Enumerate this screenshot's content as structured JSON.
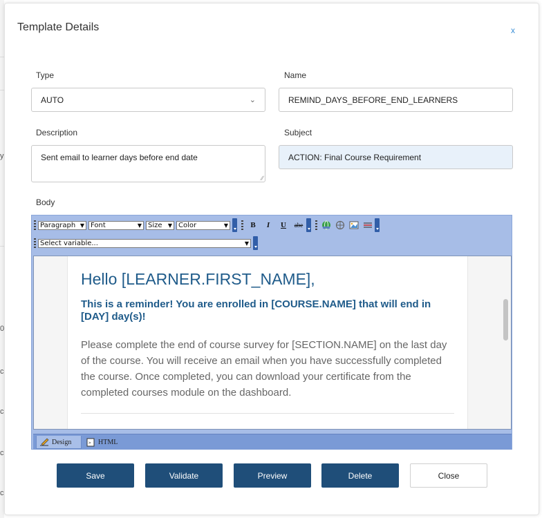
{
  "modal": {
    "title": "Template Details",
    "close_label": "x"
  },
  "form": {
    "type": {
      "label": "Type",
      "value": "AUTO"
    },
    "name": {
      "label": "Name",
      "value": "REMIND_DAYS_BEFORE_END_LEARNERS"
    },
    "description": {
      "label": "Description",
      "value": "Sent email to learner days before end date"
    },
    "subject": {
      "label": "Subject",
      "value": "ACTION: Final Course Requirement"
    },
    "body_label": "Body"
  },
  "editor": {
    "toolbar": {
      "paragraph": "Paragraph",
      "font": "Font",
      "size": "Size",
      "color": "Color",
      "bold": "B",
      "italic": "I",
      "underline": "U",
      "strike": "abe",
      "variable": "Select variable...",
      "icons": [
        "link-icon",
        "unlink-icon",
        "image-icon",
        "horizontal-rule-icon"
      ]
    },
    "content": {
      "heading": "Hello [LEARNER.FIRST_NAME],",
      "subheading": "This is a reminder! You are enrolled in [COURSE.NAME] that will end in [DAY] day(s)!",
      "paragraph": "Please complete the end of course survey for [SECTION.NAME] on the last day of the course. You will receive an email when you have successfully completed the course.  Once completed, you can download your certificate from the completed courses module on the dashboard."
    },
    "tabs": {
      "design": "Design",
      "html": "HTML"
    }
  },
  "buttons": {
    "save": "Save",
    "validate": "Validate",
    "preview": "Preview",
    "delete": "Delete",
    "close": "Close"
  },
  "background_fragments": [
    "y",
    "0,",
    "c",
    "c",
    "c",
    "c"
  ],
  "colors": {
    "primary_button": "#1f4e79",
    "heading": "#1f5b8a",
    "toolbar": "#a7bde7",
    "link": "#3b8fd6"
  }
}
